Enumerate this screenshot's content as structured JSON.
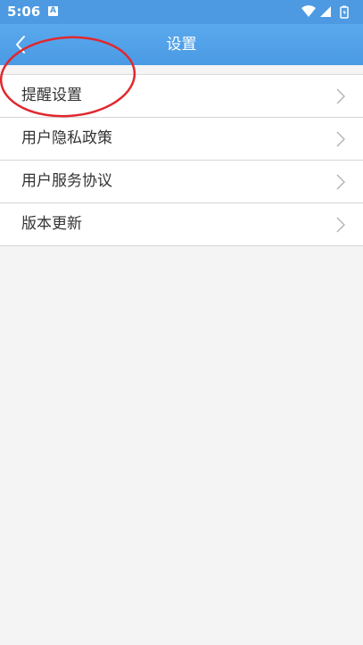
{
  "status_bar": {
    "time": "5:06",
    "notification_icon": "A",
    "icons": [
      "wifi-icon",
      "signal-icon",
      "battery-icon"
    ]
  },
  "app_bar": {
    "title": "设置",
    "back_icon": "chevron-left-icon"
  },
  "menu": {
    "items": [
      {
        "label": "提醒设置"
      },
      {
        "label": "用户隐私政策"
      },
      {
        "label": "用户服务协议"
      },
      {
        "label": "版本更新"
      }
    ]
  },
  "colors": {
    "app_bar": "#4d9ae3",
    "background": "#f4f4f4",
    "annotation": "#e0282e"
  }
}
